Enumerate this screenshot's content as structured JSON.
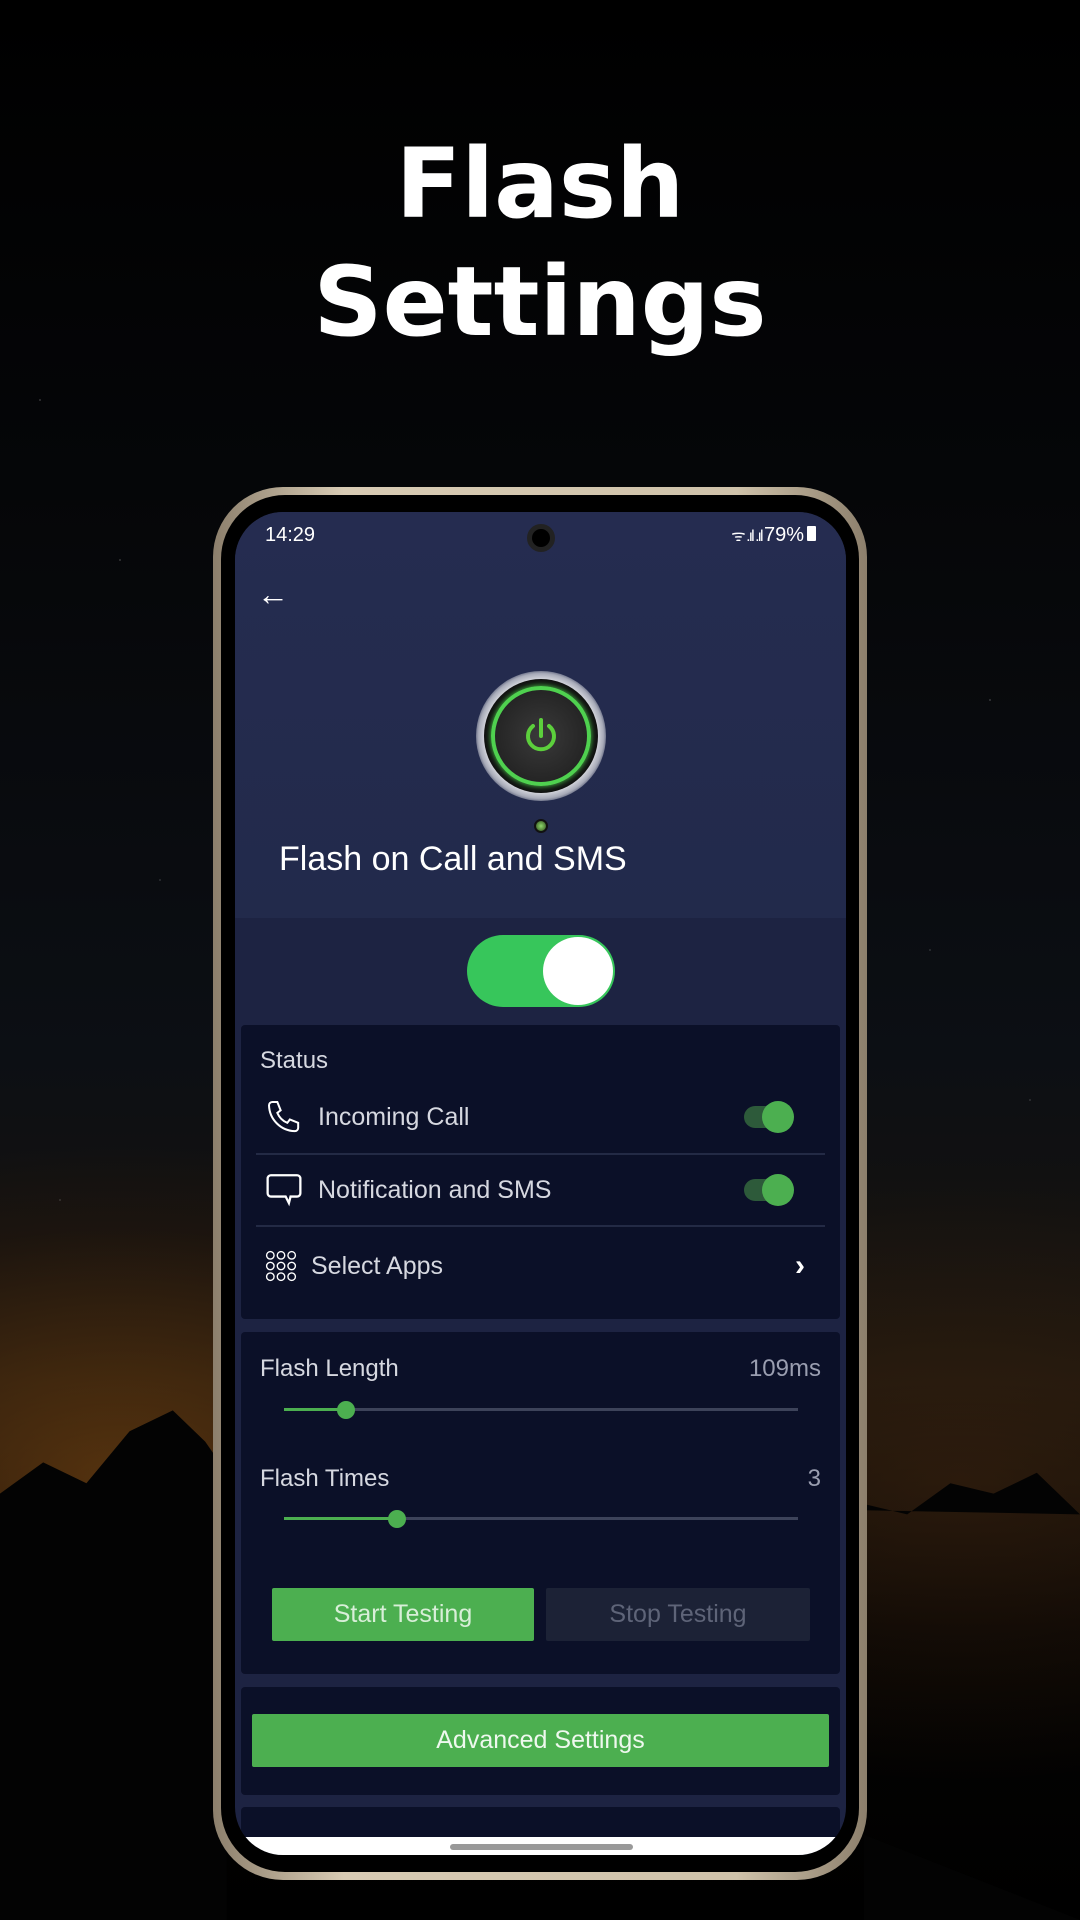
{
  "headline": {
    "line1": "Flash",
    "line2": "Settings"
  },
  "status_bar": {
    "time": "14:29",
    "battery": "79%"
  },
  "app": {
    "title": "Flash on Call and SMS",
    "master_toggle_on": true,
    "status": {
      "heading": "Status",
      "items": [
        {
          "label": "Incoming Call",
          "icon": "phone-icon",
          "enabled": true
        },
        {
          "label": "Notification and SMS",
          "icon": "message-icon",
          "enabled": true
        },
        {
          "label": "Select Apps",
          "icon": "apps-grid-icon"
        }
      ]
    },
    "flash_length": {
      "label": "Flash Length",
      "value": "109ms",
      "fraction": 0.12
    },
    "flash_times": {
      "label": "Flash Times",
      "value": "3",
      "fraction": 0.22
    },
    "start_label": "Start Testing",
    "stop_label": "Stop Testing",
    "advanced_label": "Advanced Settings"
  },
  "colors": {
    "accent": "#4caf50",
    "toggle": "#37c65b",
    "background": "#1d2342",
    "card": "#0b1028"
  }
}
